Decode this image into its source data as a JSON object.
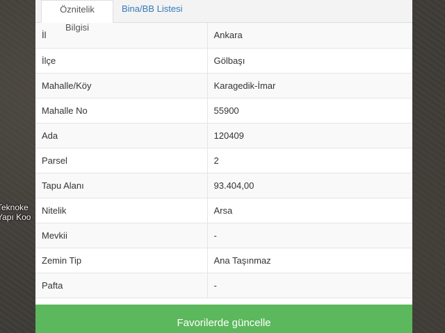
{
  "map": {
    "label_lines": [
      "Teknoke",
      "Yapı Koo"
    ]
  },
  "tabs": [
    {
      "label": "Öznitelik Bilgisi",
      "active": true
    },
    {
      "label": "Bina/BB Listesi",
      "active": false
    }
  ],
  "attributes": [
    {
      "key": "İl",
      "value": "Ankara"
    },
    {
      "key": "İlçe",
      "value": "Gölbaşı"
    },
    {
      "key": "Mahalle/Köy",
      "value": "Karagedik-İmar"
    },
    {
      "key": "Mahalle No",
      "value": "55900"
    },
    {
      "key": "Ada",
      "value": "120409"
    },
    {
      "key": "Parsel",
      "value": "2"
    },
    {
      "key": "Tapu Alanı",
      "value": "93.404,00"
    },
    {
      "key": "Nitelik",
      "value": "Arsa"
    },
    {
      "key": "Mevkii",
      "value": "-"
    },
    {
      "key": "Zemin Tip",
      "value": "Ana Taşınmaz"
    },
    {
      "key": "Pafta",
      "value": "-"
    }
  ],
  "actions": {
    "favorite_label": "Favorilerde güncelle"
  },
  "colors": {
    "primary_button": "#5cb85c",
    "tab_link": "#337ab7"
  }
}
